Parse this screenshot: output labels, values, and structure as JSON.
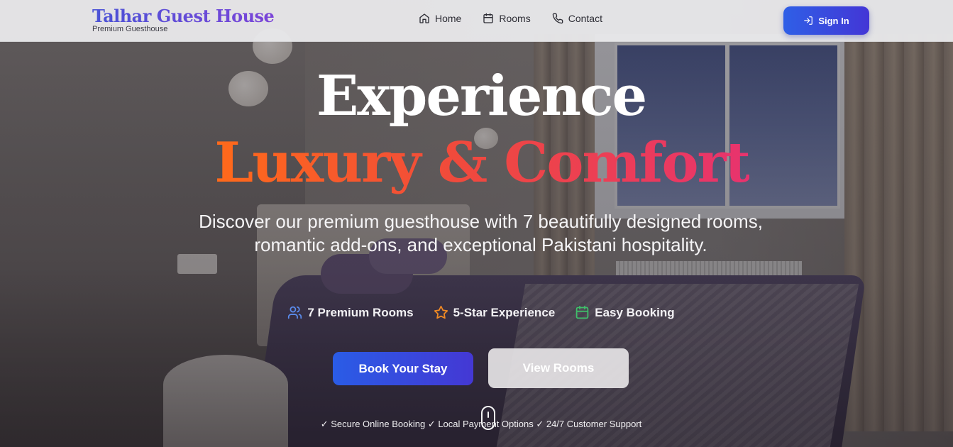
{
  "header": {
    "brand_title": "Talhar Guest House",
    "brand_subtitle": "Premium Guesthouse",
    "nav": [
      {
        "label": "Home",
        "icon": "home-icon"
      },
      {
        "label": "Rooms",
        "icon": "calendar-icon"
      },
      {
        "label": "Contact",
        "icon": "phone-icon"
      }
    ],
    "signin_label": "Sign In",
    "signin_icon": "login-icon"
  },
  "hero": {
    "title_line1": "Experience",
    "title_line2": "Luxury & Comfort",
    "description": "Discover our premium guesthouse with 7 beautifully designed rooms, romantic add-ons, and exceptional Pakistani hospitality.",
    "features": [
      {
        "label": "7 Premium Rooms",
        "icon": "users-icon",
        "color": "#5b8def"
      },
      {
        "label": "5-Star Experience",
        "icon": "star-icon",
        "color": "#f08a24"
      },
      {
        "label": "Easy Booking",
        "icon": "calendar-icon",
        "color": "#3fbf6a"
      }
    ],
    "primary_button": "Book Your Stay",
    "secondary_button": "View Rooms",
    "trust_line": "✓ Secure Online Booking ✓ Local Payment Options ✓ 24/7 Customer Support"
  },
  "colors": {
    "brand_gradient_start": "#4b53d6",
    "brand_gradient_end": "#7b44d8",
    "accent_gradient_start": "#ff6a1a",
    "accent_gradient_end": "#e8336e",
    "button_blue": "#2f5fe6"
  }
}
